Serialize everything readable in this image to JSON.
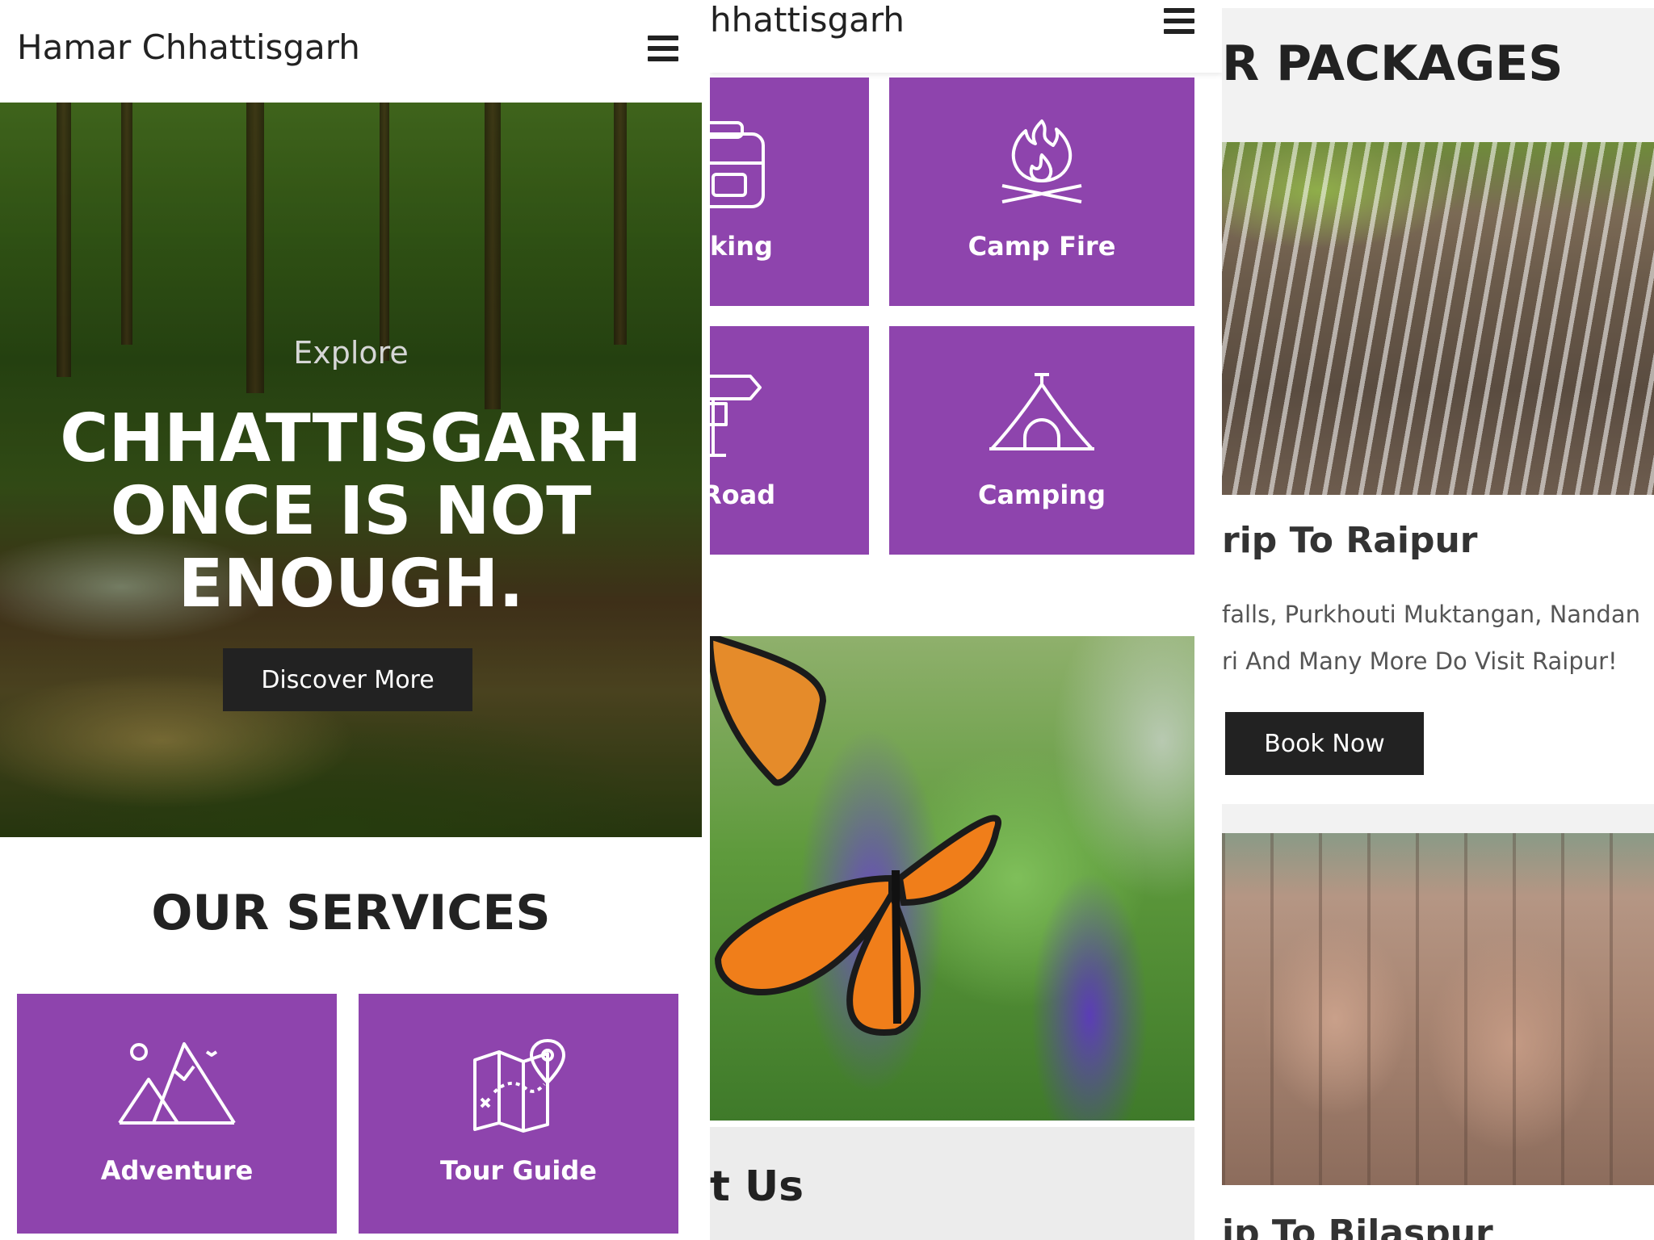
{
  "panel_left": {
    "brand": "Hamar Chhattisgarh",
    "hero": {
      "kicker": "Explore",
      "title_line1": "CHHATTISGARH",
      "title_line2": "ONCE IS NOT",
      "title_line3": "ENOUGH.",
      "button": "Discover More",
      "prev": "‹",
      "next": "›"
    },
    "services_title": "OUR SERVICES",
    "services": [
      {
        "label": "Adventure",
        "icon": "mountains-icon"
      },
      {
        "label": "Tour Guide",
        "icon": "map-pin-icon"
      }
    ]
  },
  "panel_middle": {
    "brand": "hhattisgarh",
    "services": [
      {
        "label": "king",
        "icon": "backpack-icon"
      },
      {
        "label": "Camp Fire",
        "icon": "campfire-icon"
      },
      {
        "label": "Road",
        "icon": "signpost-icon"
      },
      {
        "label": "Camping",
        "icon": "tent-icon"
      }
    ],
    "about_title": "t Us"
  },
  "panel_right": {
    "section_title": "R PACKAGES",
    "packages": [
      {
        "title": "rip To Raipur",
        "desc_line1": "falls, Purkhouti Muktangan, Nandan",
        "desc_line2": "ri And Many More Do Visit Raipur!",
        "button": "Book Now"
      },
      {
        "title": "ip To Bilaspur"
      }
    ]
  },
  "colors": {
    "service_purple": "#8e44ad",
    "dark_button": "#222222",
    "text_dark": "#222222"
  }
}
